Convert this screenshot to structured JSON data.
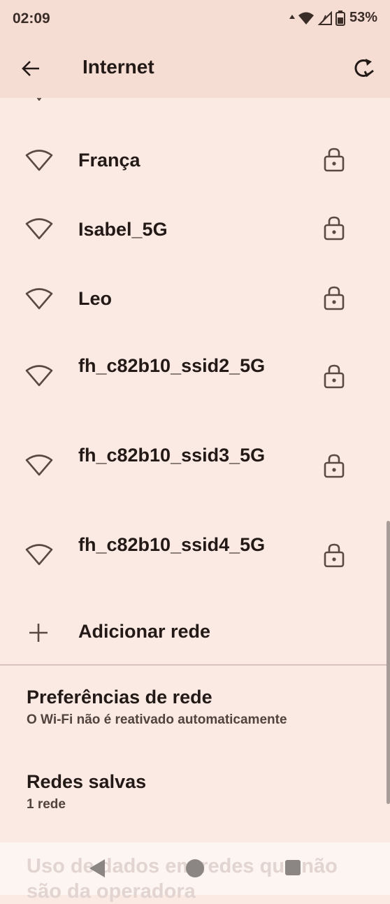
{
  "status_bar": {
    "time": "02:09",
    "battery_percent": "53%",
    "icons": [
      "data-arrow-icon",
      "wifi-signal-icon",
      "cell-signal-icon",
      "battery-icon"
    ]
  },
  "app_bar": {
    "title": "Internet",
    "back_icon": "arrow-left-icon",
    "refresh_icon": "refresh-icon"
  },
  "networks": [
    {
      "name": "França",
      "secured": true
    },
    {
      "name": "Isabel_5G",
      "secured": true
    },
    {
      "name": "Leo",
      "secured": true
    },
    {
      "name": "fh_c82b10_ssid2_5G",
      "secured": true
    },
    {
      "name": "fh_c82b10_ssid3_5G",
      "secured": true
    },
    {
      "name": "fh_c82b10_ssid4_5G",
      "secured": true
    }
  ],
  "add_network": {
    "label": "Adicionar rede"
  },
  "preferences": [
    {
      "title": "Preferências de rede",
      "subtitle": "O Wi-Fi não é reativado automaticamente"
    },
    {
      "title": "Redes salvas",
      "subtitle": "1 rede"
    }
  ],
  "faded_item": {
    "text": "Uso de dados em redes que não são da operadora"
  },
  "colors": {
    "background": "#fbe9e3",
    "header": "#f5ddd4",
    "text_primary": "#231a17",
    "text_secondary": "#51433e",
    "icon": "#5a4842"
  }
}
